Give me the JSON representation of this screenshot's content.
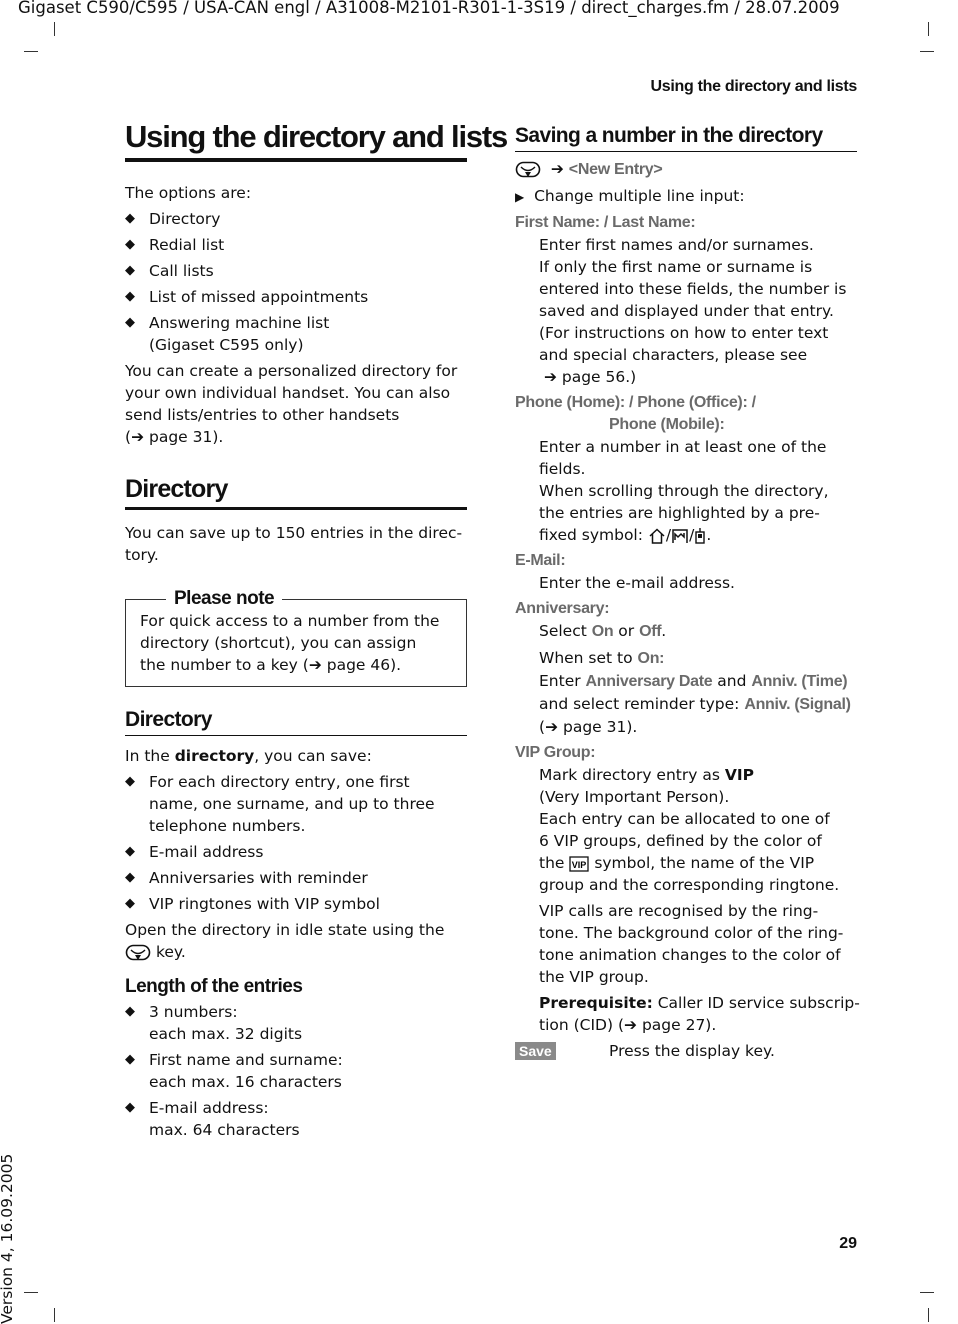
{
  "header": {
    "doc_line": "Gigaset C590/C595 / USA-CAN engl / A31008-M2101-R301-1-3S19 / direct_charges.fm / 28.07.2009",
    "running_title": "Using the directory and lists",
    "page_number": "29",
    "version": "Version 4, 16.09.2005"
  },
  "left": {
    "title": "Using the directory and lists",
    "intro": "The options are:",
    "options": [
      "Directory",
      "Redial list",
      "Call lists",
      "List of missed appointments",
      "Answering machine list",
      "(Gigaset C595 only)"
    ],
    "personal": [
      "You can create a personalized directory for",
      "your own individual handset. You can also",
      "send lists/entries to other handsets",
      "(",
      "page 31)."
    ],
    "directory_heading": "Directory",
    "capacity": [
      "You can save up to 150 entries in the direc-",
      "tory."
    ],
    "note": {
      "title": "Please note",
      "lines": [
        "For quick access to a number from the",
        "directory (shortcut), you can assign",
        "the number to a key (",
        "page 46)."
      ]
    },
    "sub_heading": "Directory",
    "in_the": [
      "In the ",
      "directory",
      ", you can save:"
    ],
    "save_items": [
      [
        "For each directory entry, one first",
        "name, one surname, and up to three",
        "telephone numbers."
      ],
      [
        "E-mail address"
      ],
      [
        "Anniversaries with reminder"
      ],
      [
        "VIP ringtones with VIP symbol"
      ]
    ],
    "open": [
      "Open the directory in idle state using the",
      "key."
    ],
    "length_heading": "Length of the entries",
    "length_items": [
      [
        "3 numbers:",
        "each max. 32 digits"
      ],
      [
        "First name and surname:",
        "each max. 16 characters"
      ],
      [
        "E-mail address:",
        "max. 64 characters"
      ]
    ]
  },
  "right": {
    "heading": "Saving a number in the directory",
    "new_entry": "<New Entry>",
    "change": "Change multiple line input:",
    "fields": {
      "name_label": "First Name: / Last Name:",
      "name_text": [
        "Enter first names and/or surnames.",
        "If only the first name or surname is",
        "entered into these fields, the number is",
        "saved and displayed under that entry.",
        "(For instructions on how to enter text",
        "and special characters, please see",
        "page 56.)"
      ],
      "phone_label": "Phone (Home): / Phone (Office): /",
      "phone_label2": "Phone (Mobile):",
      "phone_text": [
        "Enter a number in at least one of the",
        "fields.",
        "When scrolling through the directory,",
        "the entries are highlighted by a pre-",
        "fixed symbol: "
      ],
      "email_label": "E-Mail:",
      "email_text": "Enter the e-mail address.",
      "anniv_label": "Anniversary:",
      "anniv_select": [
        "Select ",
        "On",
        " or ",
        "Off",
        "."
      ],
      "anniv_when": [
        "When set to ",
        "On",
        ":"
      ],
      "anniv_enter": [
        "Enter ",
        "Anniversary Date",
        " and ",
        "Anniv. (Time)"
      ],
      "anniv_reminder": [
        "and select reminder type: ",
        "Anniv. (Signal)"
      ],
      "anniv_ref": [
        "(",
        "page 31)."
      ],
      "vip_label": "VIP Group:",
      "vip_mark": [
        "Mark directory entry as ",
        "VIP"
      ],
      "vip_text": [
        "(Very Important Person).",
        "Each entry can be allocated to one of",
        "6 VIP groups, defined by the color of",
        "the ",
        "symbol, the name of the VIP",
        "group and the corresponding ringtone."
      ],
      "vip_calls": [
        "VIP calls are recognised by the ring-",
        "tone. The background color of the ring-",
        "tone animation changes to the color of",
        "the VIP group."
      ],
      "prereq": [
        "Prerequisite:",
        " Caller ID service subscrip-",
        "tion (CID) (",
        "page 27)."
      ]
    },
    "save_key": "Save",
    "save_text": "Press the display key."
  },
  "icons": {
    "directory_key": "directory-key-icon",
    "arrow": "arrow-right-icon",
    "step": "triangle-right-icon",
    "home": "house-icon",
    "office": "factory-icon",
    "mobile": "mobile-phone-icon",
    "vip": "vip-icon"
  },
  "colors": {
    "ui_label": "#6a6a6a",
    "save_badge": "#8a8a8a"
  }
}
